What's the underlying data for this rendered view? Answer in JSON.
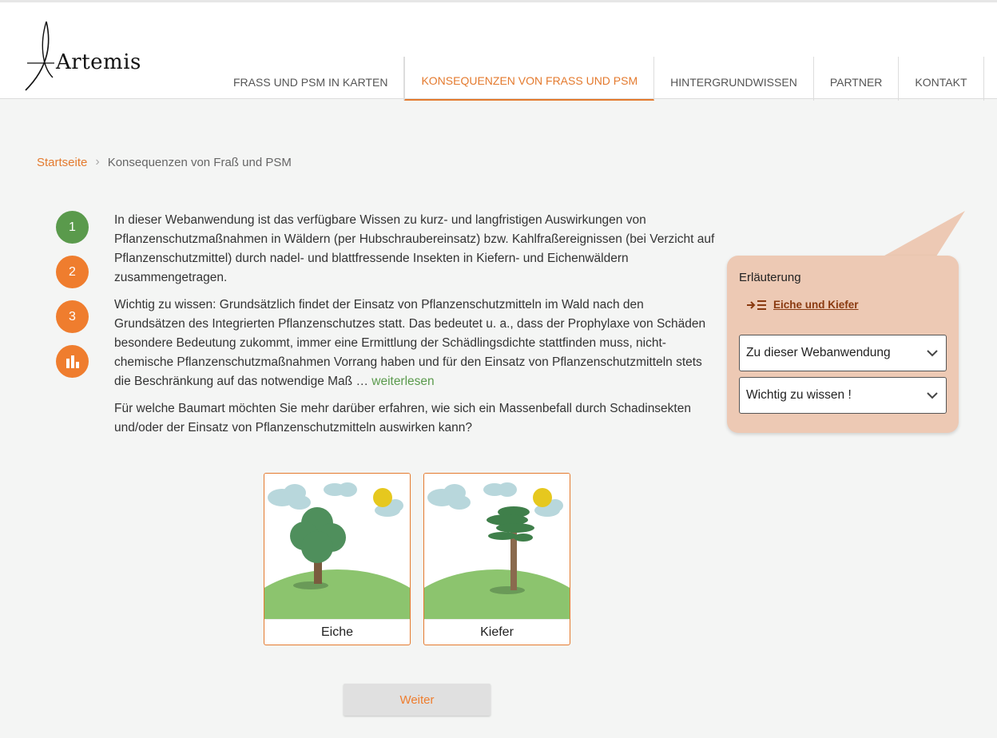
{
  "header": {
    "logo_text": "Artemis",
    "nav": [
      {
        "label": "FRASS UND PSM IN KARTEN",
        "active": false
      },
      {
        "label": "KONSEQUENZEN VON FRASS UND PSM",
        "active": true
      },
      {
        "label": "HINTERGRUNDWISSEN",
        "active": false
      },
      {
        "label": "PARTNER",
        "active": false
      },
      {
        "label": "KONTAKT",
        "active": false
      }
    ]
  },
  "breadcrumb": {
    "home": "Startseite",
    "current": "Konsequenzen von Fraß und PSM"
  },
  "steps": [
    {
      "label": "1",
      "color": "#5a9a4c"
    },
    {
      "label": "2",
      "color": "#ef7d2e"
    },
    {
      "label": "3",
      "color": "#ef7d2e"
    },
    {
      "icon": "bar-chart-icon",
      "color": "#ef7d2e"
    }
  ],
  "content": {
    "p1": "In dieser Webanwendung ist das verfügbare Wissen zu kurz- und langfristigen Auswirkungen von Pflanzenschutzmaßnahmen in Wäldern (per Hubschraubereinsatz) bzw. Kahlfraßereignissen (bei Verzicht auf Pflanzenschutzmittel) durch nadel- und blattfressende Insekten in Kiefern- und Eichenwäldern zusammengetragen.",
    "p2": "Wichtig zu wissen: Grundsätzlich findet der Einsatz von Pflanzenschutzmitteln im Wald nach den Grundsätzen des Integrierten Pflanzenschutzes statt. Das bedeutet u. a., dass der Prophylaxe von Schäden besondere Bedeutung zukommt, immer eine Ermittlung der Schädlingsdichte stattfinden muss, nicht-chemische Pflanzenschutzmaßnahmen Vorrang haben und für den Einsatz von Pflanzenschutzmitteln stets die Beschränkung auf das notwendige Maß … ",
    "readmore": "weiterlesen",
    "p3": "Für welche Baumart möchten Sie mehr darüber erfahren, wie sich ein Massenbefall durch Schadinsekten und/oder der Einsatz von Pflanzenschutzmitteln auswirken kann?"
  },
  "cards": [
    {
      "label": "Eiche"
    },
    {
      "label": "Kiefer"
    }
  ],
  "weiter_label": "Weiter",
  "panel": {
    "title": "Erläuterung",
    "link": "Eiche und Kiefer",
    "select1": "Zu dieser Webanwendung",
    "select2": "Wichtig zu wissen !"
  },
  "colors": {
    "accent": "#e47a2e",
    "green": "#5a9a4c",
    "panel_bg": "#edc9b4"
  }
}
